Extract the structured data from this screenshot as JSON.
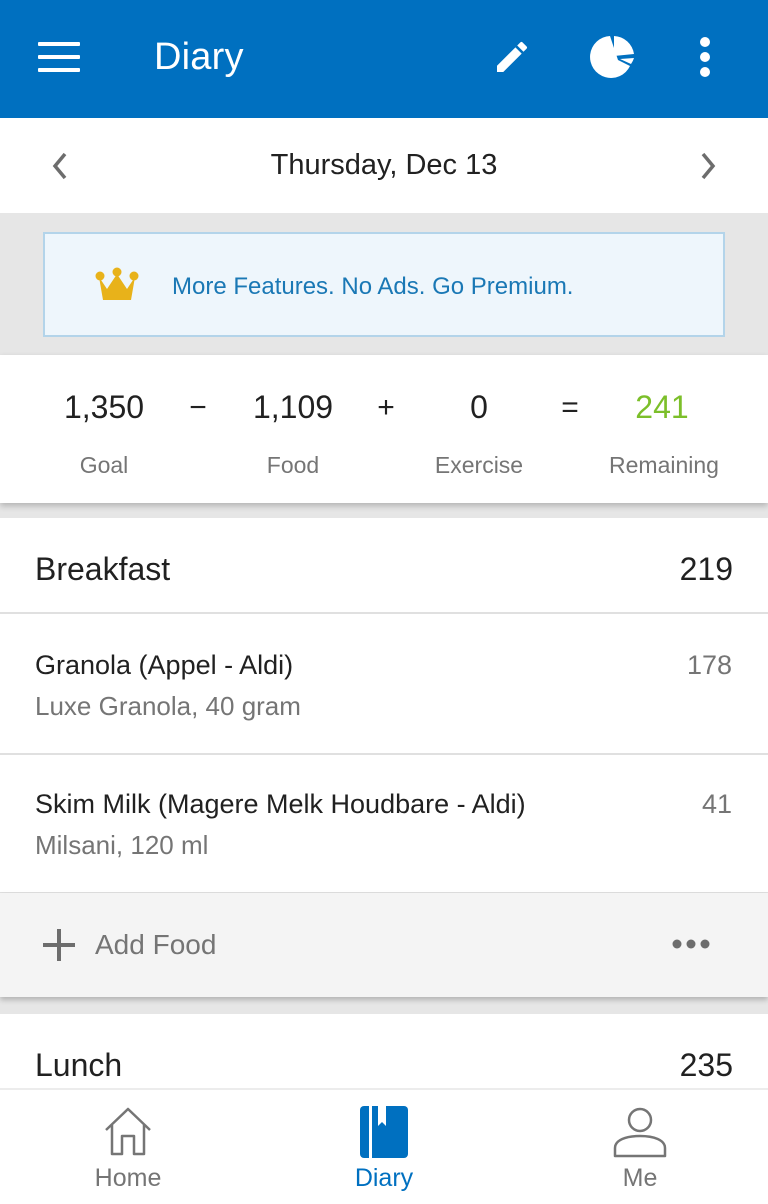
{
  "app_bar": {
    "title": "Diary",
    "icons": {
      "menu": "hamburger-menu-icon",
      "edit": "pencil-icon",
      "nutrition": "pie-chart-icon",
      "more": "more-vertical-icon"
    },
    "background_color": "#0070c0"
  },
  "date_nav": {
    "date": "Thursday, Dec 13",
    "prev_icon": "chevron-left-icon",
    "next_icon": "chevron-right-icon"
  },
  "premium_banner": {
    "text": "More Features. No Ads. Go Premium.",
    "icon": "crown-icon",
    "icon_color": "#e8b21a",
    "text_color": "#1a78b5"
  },
  "calorie_summary": {
    "goal": {
      "value": "1,350",
      "label": "Goal"
    },
    "op1": "−",
    "food": {
      "value": "1,109",
      "label": "Food"
    },
    "op2": "+",
    "exercise": {
      "value": "0",
      "label": "Exercise"
    },
    "op3": "=",
    "remaining": {
      "value": "241",
      "label": "Remaining"
    },
    "remaining_color": "#7cbf2a"
  },
  "meals": [
    {
      "name": "Breakfast",
      "calories": "219",
      "items": [
        {
          "name": "Granola (Appel - Aldi)",
          "description": "Luxe Granola, 40 gram",
          "calories": "178"
        },
        {
          "name": "Skim Milk (Magere Melk Houdbare - Aldi)",
          "description": "Milsani, 120 ml",
          "calories": "41"
        }
      ],
      "add_food_label": "Add Food"
    },
    {
      "name": "Lunch",
      "calories": "235"
    }
  ],
  "bottom_nav": {
    "items": [
      {
        "label": "Home",
        "icon": "home-icon",
        "active": false
      },
      {
        "label": "Diary",
        "icon": "diary-book-icon",
        "active": true
      },
      {
        "label": "Me",
        "icon": "person-icon",
        "active": false
      }
    ],
    "active_color": "#0070c0"
  }
}
